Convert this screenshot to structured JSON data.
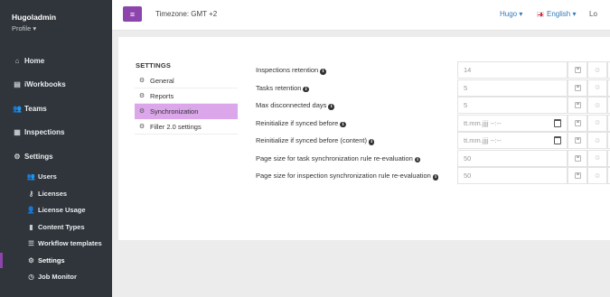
{
  "sidebar": {
    "username": "Hugoladmin",
    "profile_label": "Profile ▾",
    "items": [
      {
        "label": "Home",
        "icon": "home-icon",
        "glyph": "⌂"
      },
      {
        "label": "iWorkbooks",
        "icon": "book-icon",
        "glyph": "▤"
      },
      {
        "label": "Teams",
        "icon": "users-icon",
        "glyph": "👥"
      },
      {
        "label": "Inspections",
        "icon": "calendar-icon",
        "glyph": "▦"
      },
      {
        "label": "Settings",
        "icon": "gear-icon",
        "glyph": "⚙"
      }
    ],
    "sub_items": [
      {
        "label": "Users",
        "icon": "users-icon",
        "glyph": "👥"
      },
      {
        "label": "Licenses",
        "icon": "key-icon",
        "glyph": "⚷"
      },
      {
        "label": "License Usage",
        "icon": "user-icon",
        "glyph": "👤"
      },
      {
        "label": "Content Types",
        "icon": "file-icon",
        "glyph": "▮"
      },
      {
        "label": "Workflow templates",
        "icon": "list-icon",
        "glyph": "☰"
      },
      {
        "label": "Settings",
        "icon": "cogs-icon",
        "glyph": "⚙"
      },
      {
        "label": "Job Monitor",
        "icon": "clock-icon",
        "glyph": "◷"
      }
    ]
  },
  "topbar": {
    "menu_glyph": "≡",
    "timezone": "Timezone: GMT +2",
    "user_menu": "Hugo ▾",
    "language": "English ▾",
    "logout": "Lo"
  },
  "settings_nav": {
    "title": "SETTINGS",
    "items": [
      {
        "label": "General"
      },
      {
        "label": "Reports"
      },
      {
        "label": "Synchronization"
      },
      {
        "label": "Filler 2.0 settings"
      }
    ],
    "active_index": 2
  },
  "sync_settings": [
    {
      "label": "Inspections retention",
      "value": "14"
    },
    {
      "label": "Tasks retention",
      "value": "5"
    },
    {
      "label": "Max disconnected days",
      "value": "5"
    },
    {
      "label": "Reinitialize if synced before",
      "value": "tt.mm.jjjj --:--"
    },
    {
      "label": "Reinitialize if synced before (content)",
      "value": "tt.mm.jjjj --:--"
    },
    {
      "label": "Page size for task synchronization rule re-evaluation",
      "value": "50"
    },
    {
      "label": "Page size for inspection synchronization rule re-evaluation",
      "value": "50"
    }
  ],
  "icons": {
    "info": "i",
    "reset": "♲"
  },
  "colors": {
    "accent": "#8e44ad",
    "active_nav_bg": "#dba6ea",
    "sidebar_bg": "#2f353b",
    "link": "#337ab7"
  }
}
